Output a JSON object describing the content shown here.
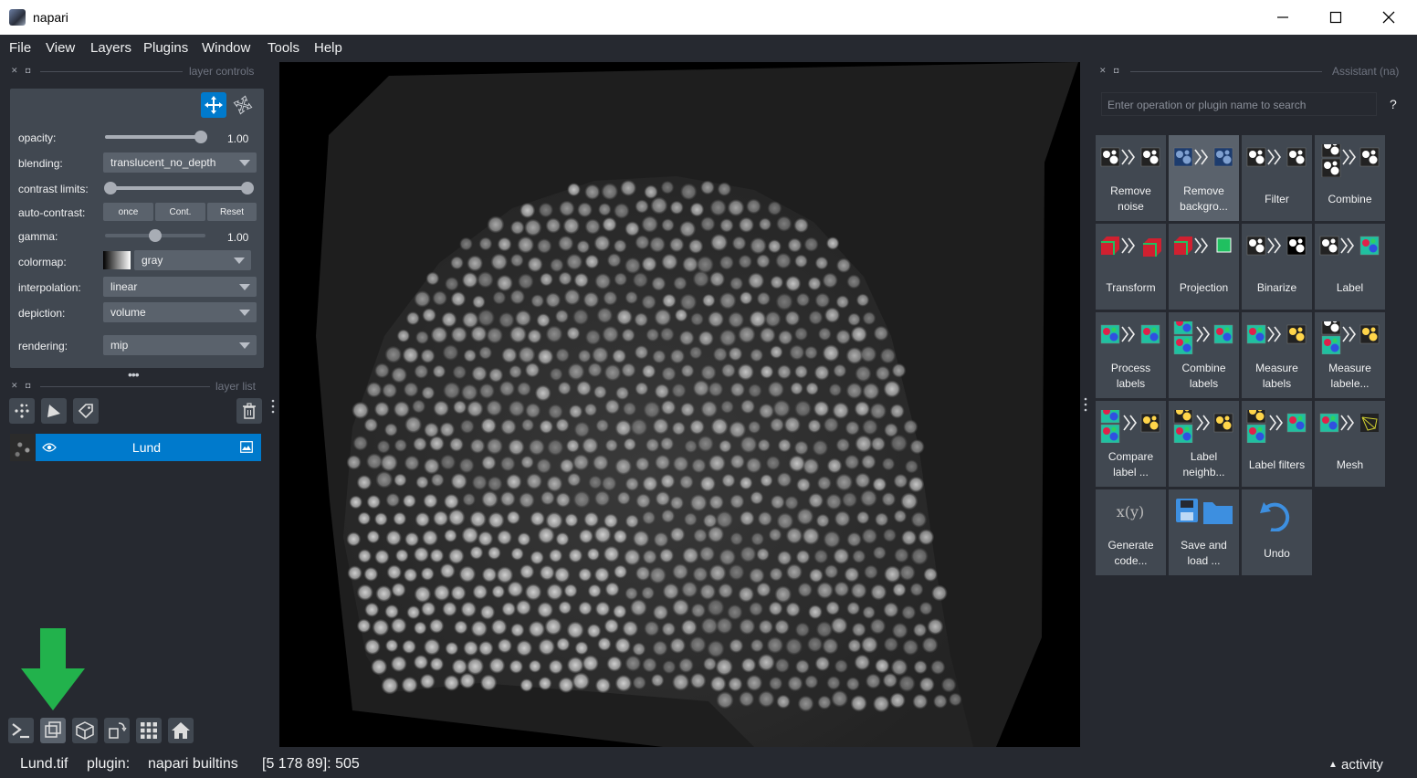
{
  "window": {
    "title": "napari"
  },
  "menu": [
    "File",
    "View",
    "Layers",
    "Plugins",
    "Window",
    "Tools",
    "Help"
  ],
  "layer_controls": {
    "dock_title": "layer controls",
    "opacity": {
      "label": "opacity:",
      "value": "1.00",
      "fraction": 1.0
    },
    "blending": {
      "label": "blending:",
      "value": "translucent_no_depth"
    },
    "contrast_limits": {
      "label": "contrast limits:",
      "low_fraction": 0.0,
      "high_fraction": 1.0
    },
    "auto_contrast": {
      "label": "auto-contrast:",
      "buttons": [
        "once",
        "Cont.",
        "Reset"
      ]
    },
    "gamma": {
      "label": "gamma:",
      "value": "1.00",
      "fraction": 0.5
    },
    "colormap": {
      "label": "colormap:",
      "value": "gray"
    },
    "interpolation": {
      "label": "interpolation:",
      "value": "linear"
    },
    "depiction": {
      "label": "depiction:",
      "value": "volume"
    },
    "rendering": {
      "label": "rendering:",
      "value": "mip"
    }
  },
  "layer_list": {
    "dock_title": "layer list",
    "layers": [
      {
        "name": "Lund"
      }
    ]
  },
  "assistant": {
    "dock_title": "Assistant (na)",
    "search_placeholder": "Enter operation or plugin name to search",
    "help": "?",
    "tiles": [
      {
        "label": "Remove\nnoise"
      },
      {
        "label": "Remove\nbackgro..."
      },
      {
        "label": "Filter"
      },
      {
        "label": "Combine"
      },
      {
        "label": "Transform"
      },
      {
        "label": "Projection"
      },
      {
        "label": "Binarize"
      },
      {
        "label": "Label"
      },
      {
        "label": "Process\nlabels"
      },
      {
        "label": "Combine\nlabels"
      },
      {
        "label": "Measure\nlabels"
      },
      {
        "label": "Measure\nlabele..."
      },
      {
        "label": "Compare\nlabel ..."
      },
      {
        "label": "Label\nneighb..."
      },
      {
        "label": "Label filters"
      },
      {
        "label": "Mesh"
      },
      {
        "label": "Generate\ncode..."
      },
      {
        "label": "Save and\nload ..."
      },
      {
        "label": "Undo"
      }
    ],
    "code_glyph": "x(y)"
  },
  "status": {
    "file": "Lund.tif",
    "plugin_label": "plugin:",
    "plugin": "napari builtins",
    "coords": "[5 178 89]: 505",
    "activity": "activity"
  },
  "colors": {
    "accent": "#007acc",
    "panel": "#414851",
    "background": "#262930",
    "arrow": "#22b24c"
  }
}
